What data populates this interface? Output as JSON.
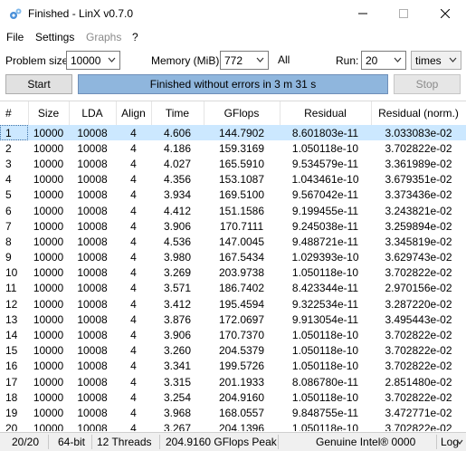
{
  "window": {
    "title": "Finished - LinX v0.7.0",
    "icon": "gear-cluster-icon"
  },
  "menu": [
    {
      "label": "File",
      "enabled": true
    },
    {
      "label": "Settings",
      "enabled": true
    },
    {
      "label": "Graphs",
      "enabled": false
    },
    {
      "label": "?",
      "enabled": true
    }
  ],
  "controls": {
    "problem_size_label": "Problem size:",
    "problem_size_value": "10000",
    "memory_label": "Memory (MiB):",
    "memory_value": "772",
    "memory_all": "All",
    "run_label": "Run:",
    "run_value": "20",
    "run_unit": "times",
    "start_label": "Start",
    "stop_label": "Stop",
    "progress_text": "Finished without errors in 3 m 31 s",
    "progress_fraction": 1.0
  },
  "table": {
    "columns": [
      "#",
      "Size",
      "LDA",
      "Align",
      "Time",
      "GFlops",
      "Residual",
      "Residual (norm.)"
    ],
    "rows": [
      [
        "1",
        "10000",
        "10008",
        "4",
        "4.606",
        "144.7902",
        "8.601803e-11",
        "3.033083e-02"
      ],
      [
        "2",
        "10000",
        "10008",
        "4",
        "4.186",
        "159.3169",
        "1.050118e-10",
        "3.702822e-02"
      ],
      [
        "3",
        "10000",
        "10008",
        "4",
        "4.027",
        "165.5910",
        "9.534579e-11",
        "3.361989e-02"
      ],
      [
        "4",
        "10000",
        "10008",
        "4",
        "4.356",
        "153.1087",
        "1.043461e-10",
        "3.679351e-02"
      ],
      [
        "5",
        "10000",
        "10008",
        "4",
        "3.934",
        "169.5100",
        "9.567042e-11",
        "3.373436e-02"
      ],
      [
        "6",
        "10000",
        "10008",
        "4",
        "4.412",
        "151.1586",
        "9.199455e-11",
        "3.243821e-02"
      ],
      [
        "7",
        "10000",
        "10008",
        "4",
        "3.906",
        "170.7111",
        "9.245038e-11",
        "3.259894e-02"
      ],
      [
        "8",
        "10000",
        "10008",
        "4",
        "4.536",
        "147.0045",
        "9.488721e-11",
        "3.345819e-02"
      ],
      [
        "9",
        "10000",
        "10008",
        "4",
        "3.980",
        "167.5434",
        "1.029393e-10",
        "3.629743e-02"
      ],
      [
        "10",
        "10000",
        "10008",
        "4",
        "3.269",
        "203.9738",
        "1.050118e-10",
        "3.702822e-02"
      ],
      [
        "11",
        "10000",
        "10008",
        "4",
        "3.571",
        "186.7402",
        "8.423344e-11",
        "2.970156e-02"
      ],
      [
        "12",
        "10000",
        "10008",
        "4",
        "3.412",
        "195.4594",
        "9.322534e-11",
        "3.287220e-02"
      ],
      [
        "13",
        "10000",
        "10008",
        "4",
        "3.876",
        "172.0697",
        "9.913054e-11",
        "3.495443e-02"
      ],
      [
        "14",
        "10000",
        "10008",
        "4",
        "3.906",
        "170.7370",
        "1.050118e-10",
        "3.702822e-02"
      ],
      [
        "15",
        "10000",
        "10008",
        "4",
        "3.260",
        "204.5379",
        "1.050118e-10",
        "3.702822e-02"
      ],
      [
        "16",
        "10000",
        "10008",
        "4",
        "3.341",
        "199.5726",
        "1.050118e-10",
        "3.702822e-02"
      ],
      [
        "17",
        "10000",
        "10008",
        "4",
        "3.315",
        "201.1933",
        "8.086780e-11",
        "2.851480e-02"
      ],
      [
        "18",
        "10000",
        "10008",
        "4",
        "3.254",
        "204.9160",
        "1.050118e-10",
        "3.702822e-02"
      ],
      [
        "19",
        "10000",
        "10008",
        "4",
        "3.968",
        "168.0557",
        "9.848755e-11",
        "3.472771e-02"
      ],
      [
        "20",
        "10000",
        "10008",
        "4",
        "3.267",
        "204.1396",
        "1.050118e-10",
        "3.702822e-02"
      ]
    ],
    "selected_row": 0
  },
  "status": {
    "runs": "20/20",
    "arch": "64-bit",
    "threads": "12 Threads",
    "peak": "204.9160 GFlops Peak",
    "cpu": "Genuine Intel® 0000",
    "log": "Log"
  }
}
